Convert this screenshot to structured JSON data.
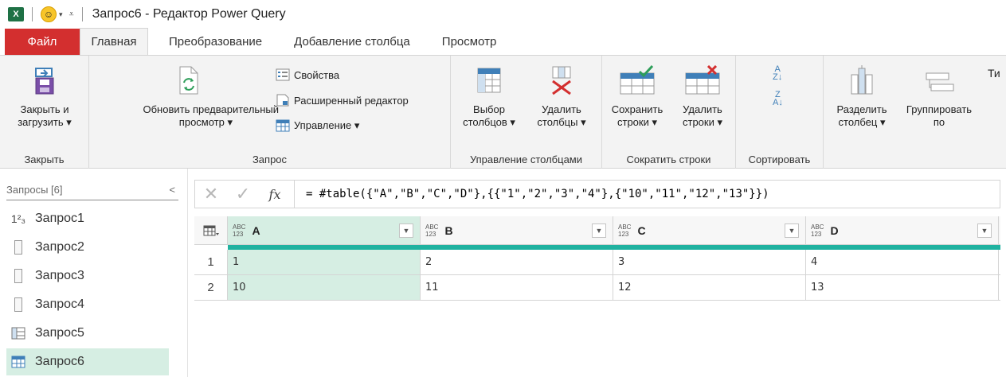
{
  "titlebar": {
    "app_icon": "X",
    "title": "Запрос6 - Редактор Power Query"
  },
  "tabs": [
    {
      "label": "Файл"
    },
    {
      "label": "Главная"
    },
    {
      "label": "Преобразование"
    },
    {
      "label": "Добавление столбца"
    },
    {
      "label": "Просмотр"
    }
  ],
  "ribbon": {
    "close_load_line1": "Закрыть и",
    "close_load_line2": "загрузить ▾",
    "group_close": "Закрыть",
    "refresh_line1": "Обновить предварительный",
    "refresh_line2": "просмотр ▾",
    "properties": "Свойства",
    "advanced_editor": "Расширенный редактор",
    "manage": "Управление ▾",
    "group_query": "Запрос",
    "choose_cols_line1": "Выбор",
    "choose_cols_line2": "столбцов ▾",
    "remove_cols_line1": "Удалить",
    "remove_cols_line2": "столбцы ▾",
    "group_manage_cols": "Управление столбцами",
    "keep_rows_line1": "Сохранить",
    "keep_rows_line2": "строки ▾",
    "remove_rows_line1": "Удалить",
    "remove_rows_line2": "строки ▾",
    "group_reduce_rows": "Сократить строки",
    "group_sort": "Сортировать",
    "split_col_line1": "Разделить",
    "split_col_line2": "столбец ▾",
    "group_by_line1": "Группировать",
    "group_by_line2": "по",
    "cut_label": "Ти"
  },
  "queries": {
    "header": "Запросы [6]",
    "items": [
      {
        "label": "Запрос1",
        "icon": "number-icon"
      },
      {
        "label": "Запрос2",
        "icon": "text-query-icon"
      },
      {
        "label": "Запрос3",
        "icon": "text-query-icon"
      },
      {
        "label": "Запрос4",
        "icon": "text-query-icon"
      },
      {
        "label": "Запрос5",
        "icon": "table-query-icon"
      },
      {
        "label": "Запрос6",
        "icon": "table-query-icon"
      }
    ],
    "selected": "Запрос6"
  },
  "formula": {
    "cancel": "✕",
    "commit": "✓",
    "fx": "fx",
    "text": "= #table({\"A\",\"B\",\"C\",\"D\"},{{\"1\",\"2\",\"3\",\"4\"},{\"10\",\"11\",\"12\",\"13\"}})"
  },
  "grid": {
    "columns": [
      {
        "name": "A",
        "type_top": "ABC",
        "type_bottom": "123"
      },
      {
        "name": "B",
        "type_top": "ABC",
        "type_bottom": "123"
      },
      {
        "name": "C",
        "type_top": "ABC",
        "type_bottom": "123"
      },
      {
        "name": "D",
        "type_top": "ABC",
        "type_bottom": "123"
      }
    ],
    "rows": [
      {
        "n": "1",
        "cells": [
          "1",
          "2",
          "3",
          "4"
        ]
      },
      {
        "n": "2",
        "cells": [
          "10",
          "11",
          "12",
          "13"
        ]
      }
    ]
  },
  "colors": {
    "file_tab": "#d32f2f",
    "selection": "#d6eee3",
    "teal_bar": "#20b2a0"
  }
}
